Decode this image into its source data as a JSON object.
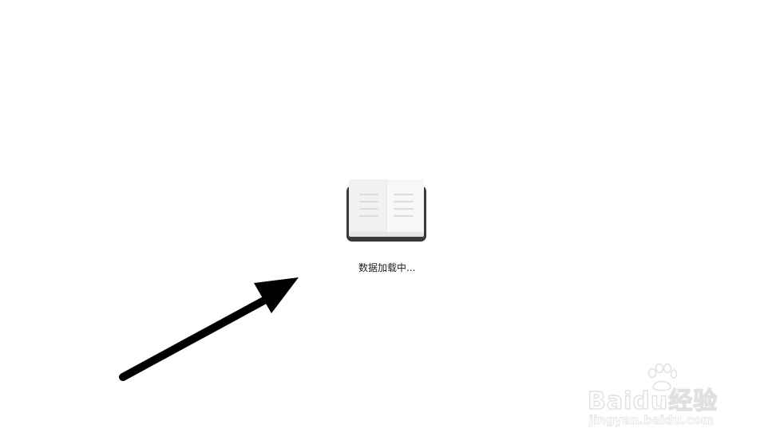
{
  "loading": {
    "text": "数据加载中...",
    "icon": "open-book-icon"
  },
  "annotation": {
    "icon": "arrow-icon",
    "color": "#000000"
  },
  "watermark": {
    "logo_text": "Baidu经验",
    "url": "jingyan.baidu.com"
  }
}
